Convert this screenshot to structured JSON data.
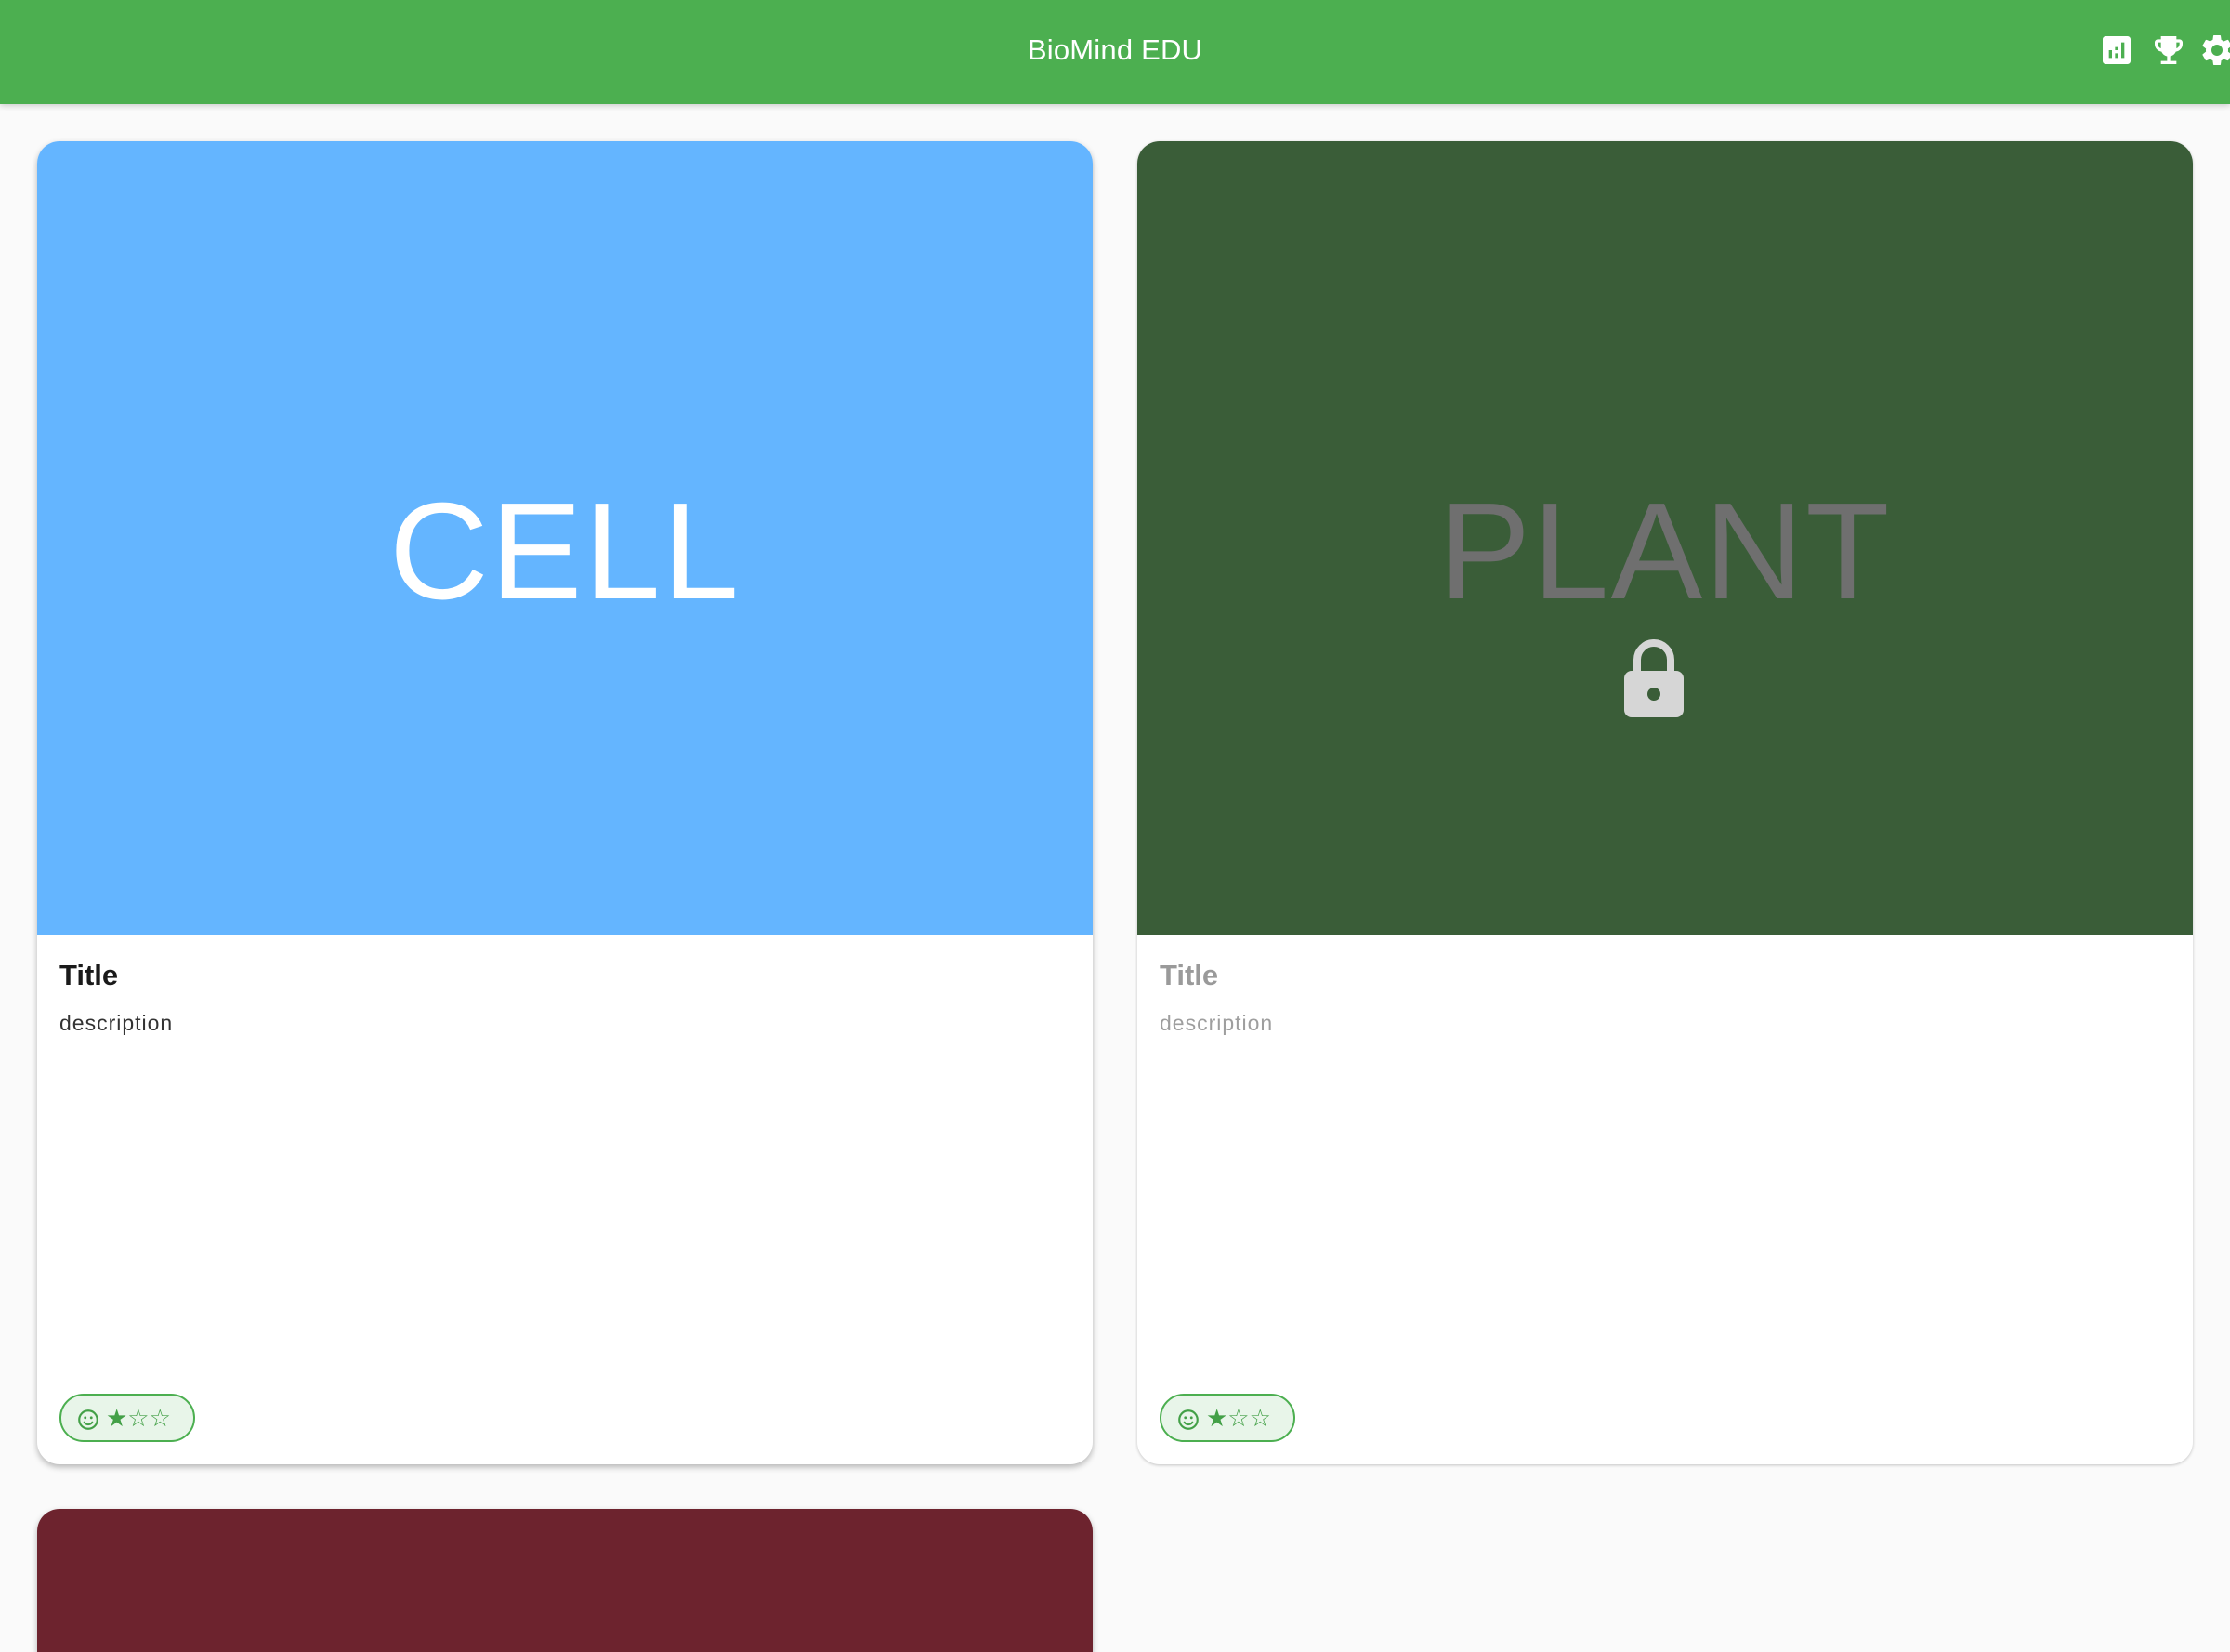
{
  "app": {
    "title": "BioMind EDU",
    "colors": {
      "primary": "#4caf50",
      "background": "#fafafa",
      "chip_fill": "#e8f5e9"
    }
  },
  "toolbar": {
    "actions": [
      {
        "icon": "stats-icon"
      },
      {
        "icon": "trophy-icon"
      },
      {
        "icon": "settings-icon"
      }
    ]
  },
  "cards": [
    {
      "image_word": "CELL",
      "image_color": "#64b5ff",
      "title": "Title",
      "description": "description",
      "locked": false,
      "status_icon": "smiley-icon",
      "stars": "★☆☆",
      "stars_earned": 1,
      "stars_total": 3
    },
    {
      "image_word": "PLANT",
      "image_color": "#3a5d38",
      "title": "Title",
      "description": "description",
      "locked": true,
      "lock_icon": "lock-icon",
      "status_icon": "smiley-icon",
      "stars": "★☆☆",
      "stars_earned": 1,
      "stars_total": 3
    },
    {
      "image_color": "#6d232e",
      "locked": false
    }
  ]
}
